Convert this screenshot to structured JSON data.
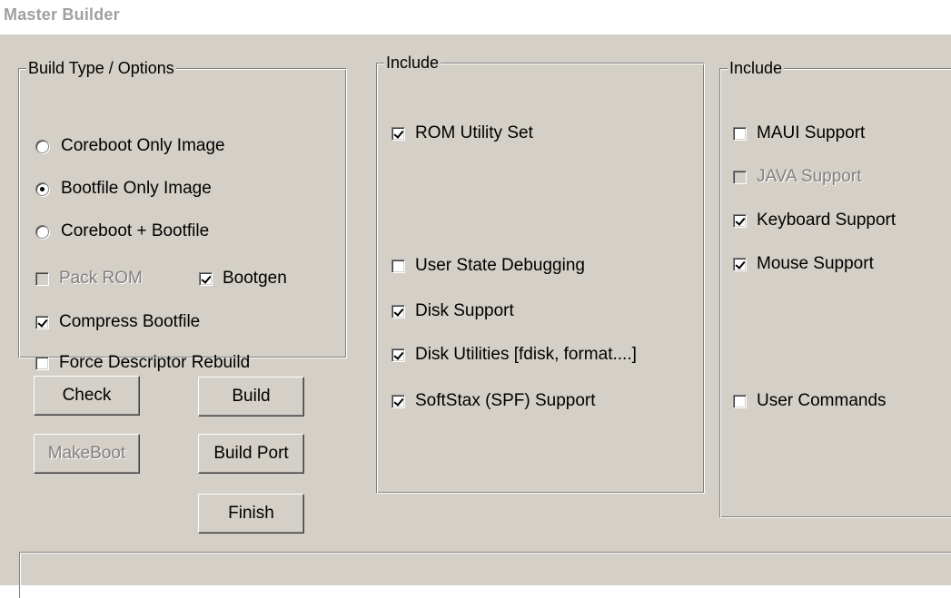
{
  "window": {
    "title": "Master Builder"
  },
  "build_group": {
    "legend": "Build Type / Options",
    "radios": [
      {
        "label": "Coreboot Only Image",
        "selected": false
      },
      {
        "label": "Bootfile Only Image",
        "selected": true
      },
      {
        "label": "Coreboot + Bootfile",
        "selected": false
      }
    ],
    "pack_rom": {
      "label": "Pack ROM",
      "checked": false,
      "enabled": false
    },
    "bootgen": {
      "label": "Bootgen",
      "checked": true,
      "enabled": true
    },
    "compress": {
      "label": "Compress Bootfile",
      "checked": true,
      "enabled": true
    },
    "force": {
      "label": "Force Descriptor Rebuild",
      "checked": false,
      "enabled": true
    }
  },
  "buttons": {
    "check": "Check",
    "build": "Build",
    "makeboot": "MakeBoot",
    "build_port": "Build Port",
    "finish": "Finish"
  },
  "include_group_1": {
    "legend": "Include",
    "items": [
      {
        "label": "ROM Utility Set",
        "checked": true
      },
      {
        "label": "User State Debugging",
        "checked": false
      },
      {
        "label": "Disk Support",
        "checked": true
      },
      {
        "label": "Disk Utilities [fdisk, format....]",
        "checked": true
      },
      {
        "label": "SoftStax (SPF) Support",
        "checked": true
      }
    ]
  },
  "include_group_2": {
    "legend": "Include",
    "items": [
      {
        "label": "MAUI Support",
        "checked": false,
        "enabled": true
      },
      {
        "label": "JAVA Support",
        "checked": false,
        "enabled": false
      },
      {
        "label": "Keyboard Support",
        "checked": true,
        "enabled": true
      },
      {
        "label": "Mouse Support",
        "checked": true,
        "enabled": true
      },
      {
        "label": "User Commands",
        "checked": false,
        "enabled": true
      }
    ]
  }
}
